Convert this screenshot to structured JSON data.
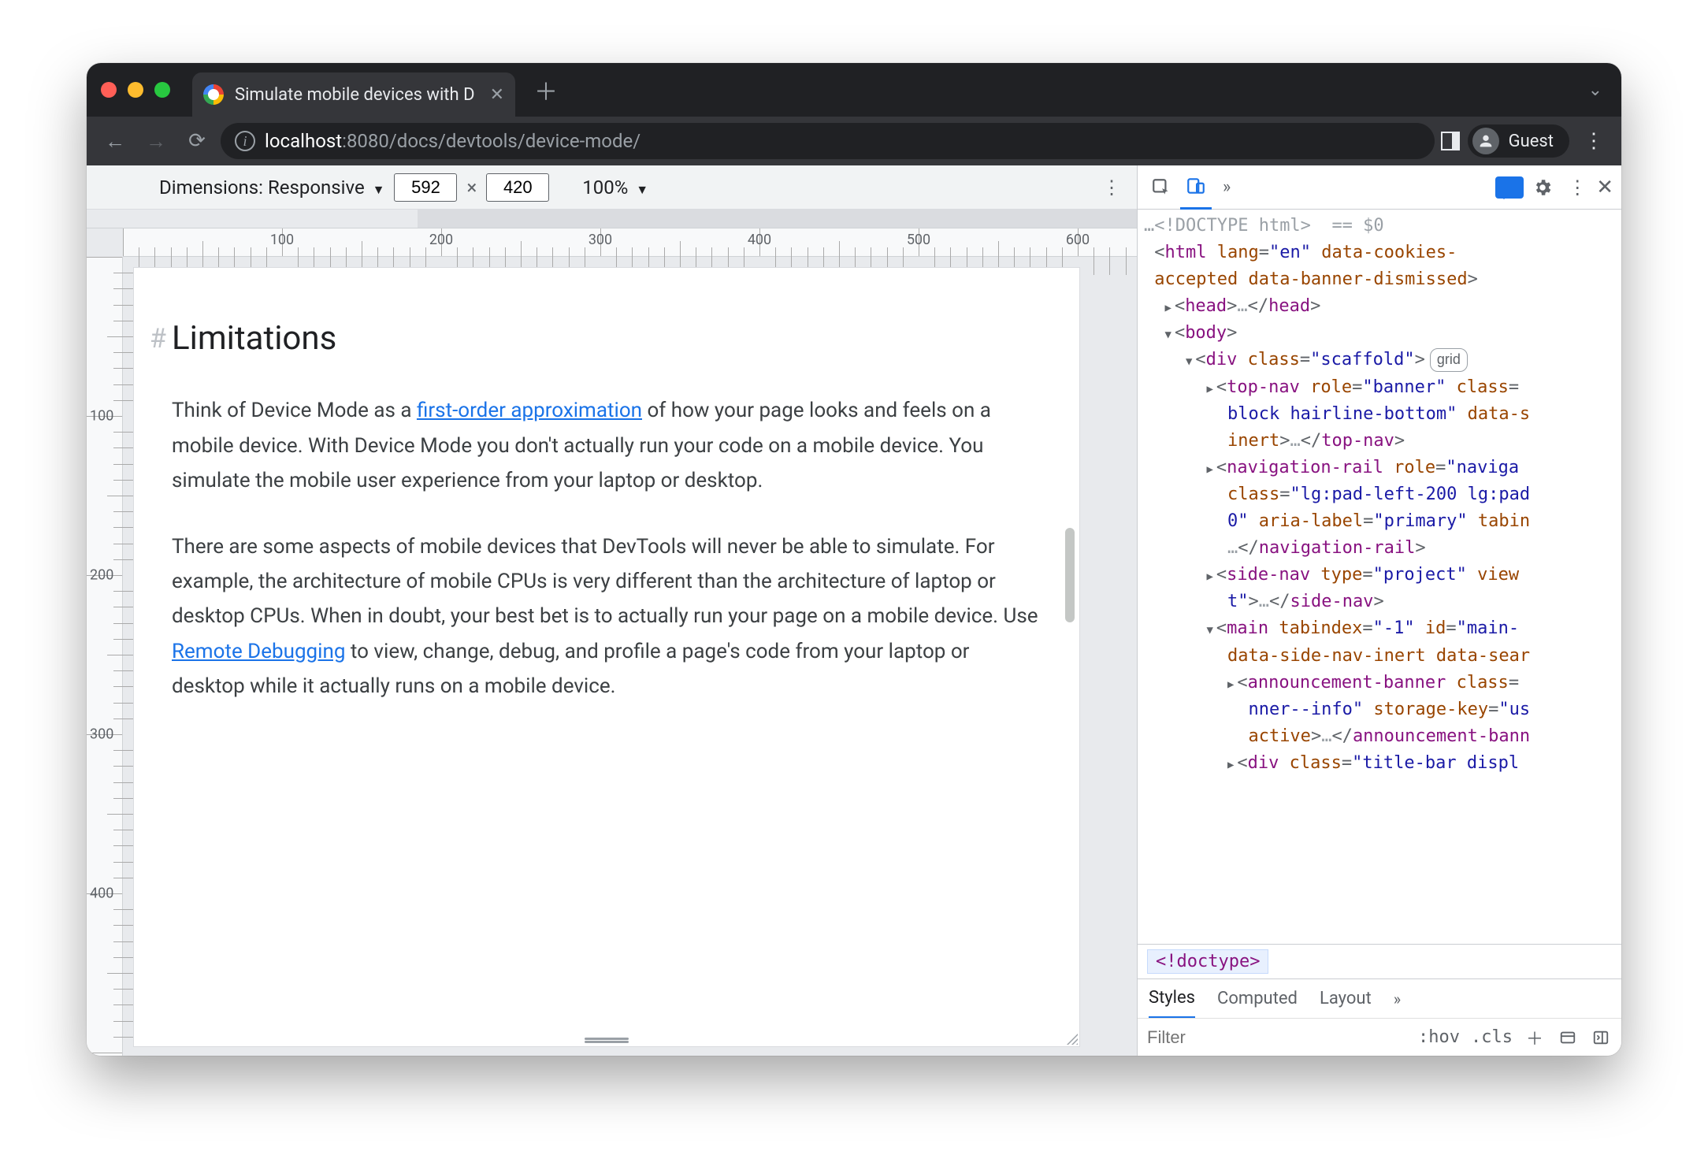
{
  "browser": {
    "tab_title": "Simulate mobile devices with D",
    "url_host": "localhost",
    "url_port": ":8080",
    "url_path": "/docs/devtools/device-mode/",
    "profile_label": "Guest"
  },
  "device_toolbar": {
    "label": "Dimensions:",
    "preset": "Responsive",
    "width": "592",
    "height": "420",
    "separator": "×",
    "zoom": "100%"
  },
  "rulers": {
    "h_marks": [
      "100",
      "200",
      "300",
      "400",
      "500",
      "600"
    ],
    "v_marks": [
      "100",
      "200",
      "300",
      "400"
    ]
  },
  "page": {
    "heading": "Limitations",
    "hash": "#",
    "p1_a": "Think of Device Mode as a ",
    "p1_link": "first-order approximation",
    "p1_b": " of how your page looks and feels on a mobile device. With Device Mode you don't actually run your code on a mobile device. You simulate the mobile user experience from your laptop or desktop.",
    "p2_a": "There are some aspects of mobile devices that DevTools will never be able to simulate. For example, the architecture of mobile CPUs is very different than the architecture of laptop or desktop CPUs. When in doubt, your best bet is to actually run your page on a mobile device. Use ",
    "p2_link": "Remote Debugging",
    "p2_b": " to view, change, debug, and profile a page's code from your laptop or desktop while it actually runs on a mobile device."
  },
  "devtools": {
    "doctype_line": "<!DOCTYPE html>",
    "sel0": "== $0",
    "badge_grid": "grid",
    "crumb": "<!doctype>",
    "styles_tabs": {
      "styles": "Styles",
      "computed": "Computed",
      "layout": "Layout"
    },
    "styles_toolbar": {
      "filter_placeholder": "Filter",
      "hov": ":hov",
      "cls": ".cls"
    },
    "elements": {
      "l1_open": "<",
      "l1_tag": "html",
      "l1_attrs": " lang=\"en\" data-cookies-accepted data-banner-dismissed",
      "l1_close": ">",
      "head_open": "<head>",
      "ellips": "…",
      "head_close": "</head>",
      "body_open": "<body>",
      "div_open": "<div class=\"scaffold\">",
      "topnav_a": "<top-nav role=\"banner\" class=",
      "topnav_b": "block hairline-bottom\" data-s",
      "topnav_c": "inert>",
      "topnav_close": "</top-nav>",
      "navrail_a": "<navigation-rail role=\"naviga",
      "navrail_b": "class=\"lg:pad-left-200 lg:pad",
      "navrail_c": "0\" aria-label=\"primary\" tabin",
      "navrail_close": "</navigation-rail>",
      "sidenav_a": "<side-nav type=\"project\" view",
      "sidenav_b": "t\">",
      "sidenav_close": "</side-nav>",
      "main_a": "<main tabindex=\"-1\" id=\"main-",
      "main_b": "data-side-nav-inert data-sear",
      "ann_a": "<announcement-banner class=",
      "ann_b": "nner--info\" storage-key=\"us",
      "ann_c": "active>",
      "ann_close": "</announcement-bann",
      "titlebar_a": "<div class=\"title-bar displ"
    }
  }
}
